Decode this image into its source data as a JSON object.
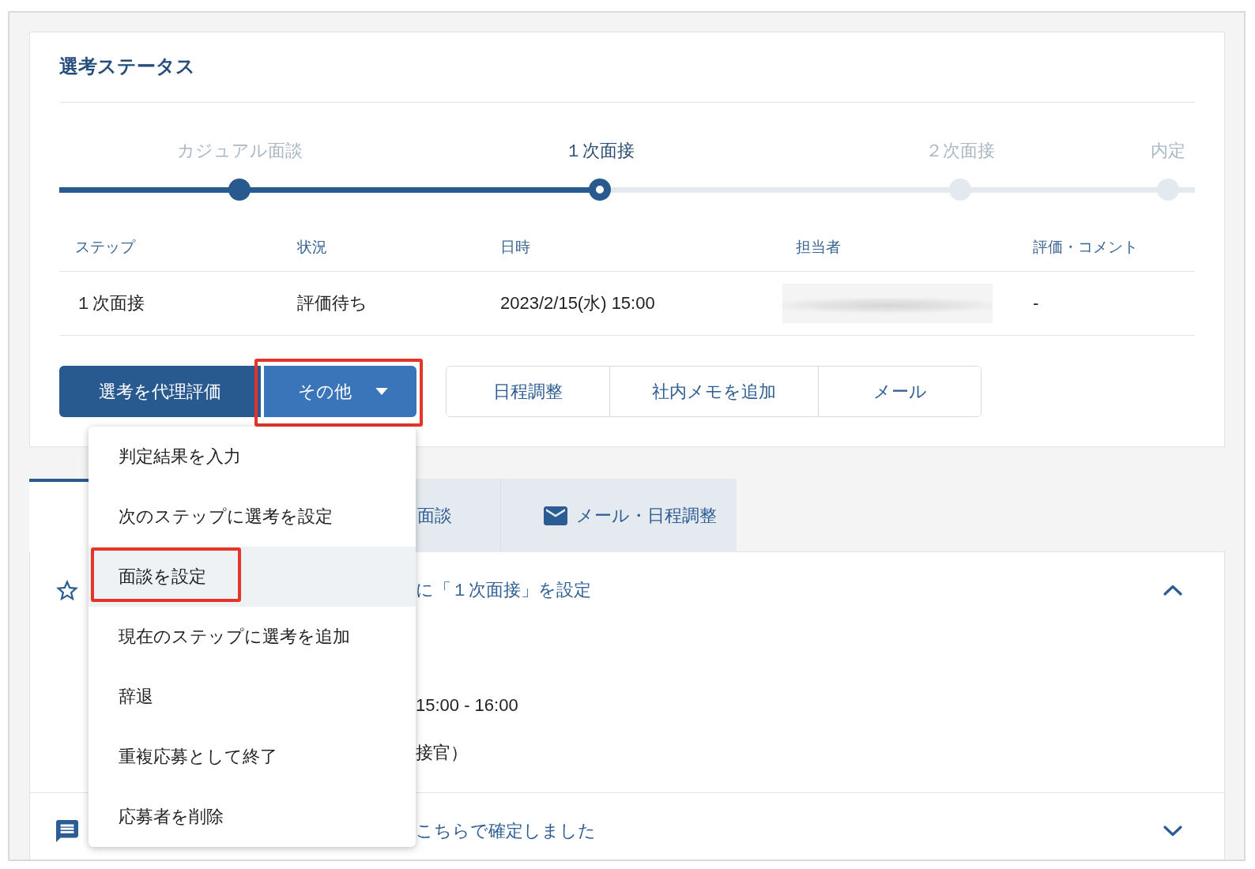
{
  "selection_status": {
    "title": "選考ステータス",
    "steps": [
      {
        "label": "カジュアル面談",
        "completed": true,
        "current": false
      },
      {
        "label": "１次面接",
        "completed": false,
        "current": true
      },
      {
        "label": "２次面接",
        "completed": false,
        "current": false
      },
      {
        "label": "内定",
        "completed": false,
        "current": false
      }
    ],
    "table": {
      "columns": [
        "ステップ",
        "状況",
        "日時",
        "担当者",
        "評価・コメント"
      ],
      "rows": [
        {
          "cells": [
            {
              "kind": "text",
              "text": "１次面接"
            },
            {
              "kind": "text",
              "text": "評価待ち"
            },
            {
              "kind": "text",
              "text": "2023/2/15(水) 15:00"
            },
            {
              "kind": "blurred"
            },
            {
              "kind": "text",
              "text": "-"
            }
          ]
        }
      ]
    },
    "primary_actions": [
      {
        "label": "選考を代理評価",
        "kind": "button",
        "annotated": false
      },
      {
        "label": "その他",
        "kind": "menu",
        "annotated": true,
        "expanded": true,
        "menu_items": [
          {
            "label": "判定結果を入力",
            "hovered": false,
            "annotated": false
          },
          {
            "label": "次のステップに選考を設定",
            "hovered": false,
            "annotated": false
          },
          {
            "label": "面談を設定",
            "hovered": true,
            "annotated": true
          },
          {
            "label": "現在のステップに選考を追加",
            "hovered": false,
            "annotated": false
          },
          {
            "label": "辞退",
            "hovered": false,
            "annotated": false
          },
          {
            "label": "重複応募として終了",
            "hovered": false,
            "annotated": false
          },
          {
            "label": "応募者を削除",
            "hovered": false,
            "annotated": false
          }
        ]
      }
    ],
    "secondary_actions": [
      "日程調整",
      "社内メモを追加",
      "メール"
    ]
  },
  "tabs": [
    {
      "kind": "plain",
      "selected": true
    },
    {
      "kind": "plain",
      "label": "面談",
      "selected": false
    },
    {
      "kind": "messages",
      "label": "メール・日程調整",
      "selected": false
    }
  ],
  "timeline": [
    {
      "kind": "step_event",
      "title": "に「１次面接」を設定",
      "expanded": true,
      "details": [
        "15:00 - 16:00",
        "接官）"
      ]
    },
    {
      "kind": "message",
      "title": "こちらで確定しました",
      "expanded": false
    }
  ]
}
